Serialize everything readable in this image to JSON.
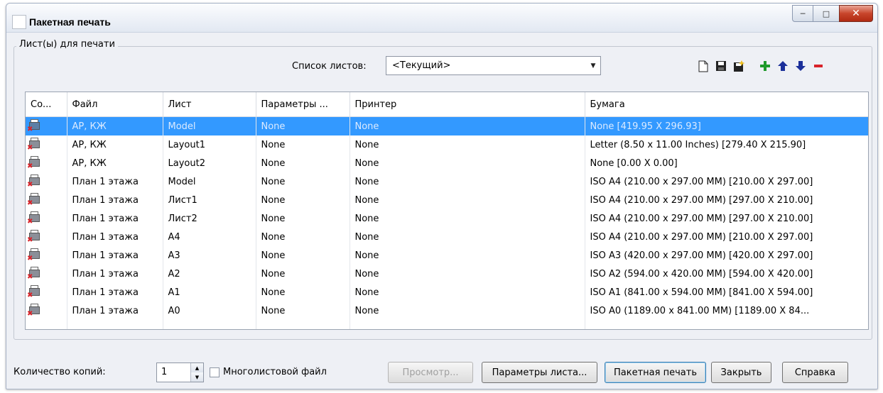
{
  "window": {
    "title": "Пакетная печать"
  },
  "group": {
    "label": "Лист(ы) для печати"
  },
  "sheetlist": {
    "label": "Список листов:",
    "value": "<Текущий>"
  },
  "toolbar": {
    "icons": [
      "new-list-icon",
      "save-list-icon",
      "load-list-icon",
      "add-icon",
      "move-up-icon",
      "move-down-icon",
      "remove-icon"
    ]
  },
  "table": {
    "headers": [
      "Со...",
      "Файл",
      "Лист",
      "Параметры ...",
      "Принтер",
      "Бумага"
    ],
    "rows": [
      [
        "AP, КЖ",
        "Model",
        "None",
        "None",
        "None [419.95 X 296.93]"
      ],
      [
        "AP, КЖ",
        "Layout1",
        "None",
        "None",
        "Letter (8.50 x 11.00 Inches) [279.40 X 215.90]"
      ],
      [
        "AP, КЖ",
        "Layout2",
        "None",
        "None",
        "None [0.00 X 0.00]"
      ],
      [
        "План 1 этажа",
        "Model",
        "None",
        "None",
        "ISO A4 (210.00 x 297.00 MM) [210.00 X 297.00]"
      ],
      [
        "План 1 этажа",
        "Лист1",
        "None",
        "None",
        "ISO A4 (210.00 x 297.00 MM) [297.00 X 210.00]"
      ],
      [
        "План 1 этажа",
        "Лист2",
        "None",
        "None",
        "ISO A4 (210.00 x 297.00 MM) [297.00 X 210.00]"
      ],
      [
        "План 1 этажа",
        "A4",
        "None",
        "None",
        "ISO A4 (210.00 x 297.00 MM) [210.00 X 297.00]"
      ],
      [
        "План 1 этажа",
        "A3",
        "None",
        "None",
        "ISO A3 (420.00 x 297.00 MM) [420.00 X 297.00]"
      ],
      [
        "План 1 этажа",
        "A2",
        "None",
        "None",
        "ISO A2 (594.00 x 420.00 MM) [594.00 X 420.00]"
      ],
      [
        "План 1 этажа",
        "A1",
        "None",
        "None",
        "ISO A1 (841.00 x 594.00 MM) [841.00 X 594.00]"
      ],
      [
        "План 1 этажа",
        "A0",
        "None",
        "None",
        "ISO A0 (1189.00 x 841.00 MM) [1189.00 X 84..."
      ]
    ]
  },
  "bottom": {
    "copies_label": "Количество копий:",
    "copies_value": "1",
    "multisheet_label": "Многолистовой файл",
    "preview": "Просмотр...",
    "page_setup": "Параметры листа...",
    "batch_plot": "Пакетная печать",
    "close": "Закрыть",
    "help": "Справка"
  }
}
